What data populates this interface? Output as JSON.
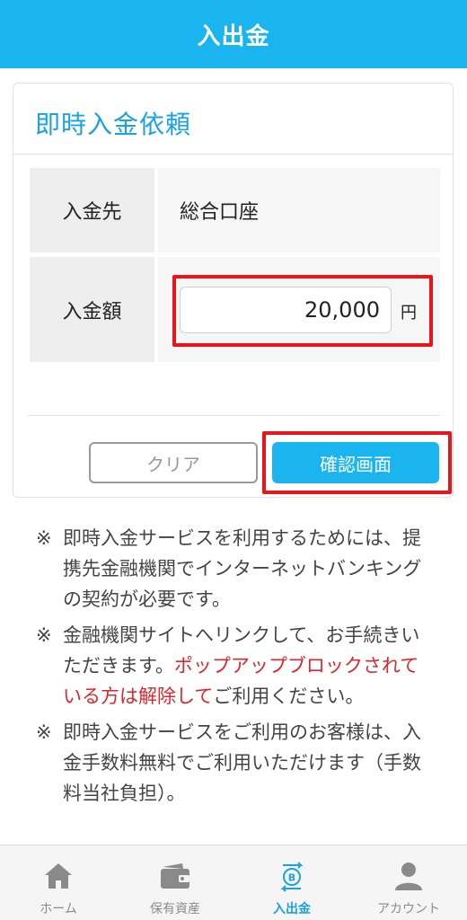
{
  "header": {
    "title": "入出金"
  },
  "card": {
    "title": "即時入金依頼",
    "rows": [
      {
        "label": "入金先",
        "value": "総合口座"
      },
      {
        "label": "入金額",
        "value": "20,000",
        "unit": "円"
      }
    ]
  },
  "buttons": {
    "clear": "クリア",
    "confirm": "確認画面"
  },
  "notes": [
    {
      "mark": "※",
      "text": "即時入金サービスを利用するためには、提携先金融機関でインターネットバンキングの契約が必要です。"
    },
    {
      "mark": "※",
      "text_before": "金融機関サイトへリンクして、お手続きいただきます。",
      "text_red": "ポップアップブロックされている方は解除して",
      "text_after": "ご利用ください。"
    },
    {
      "mark": "※",
      "text": "即時入金サービスをご利用のお客様は、入金手数料無料でご利用いただけます（手数料当社負担）。"
    }
  ],
  "tabbar": {
    "items": [
      {
        "label": "ホーム",
        "icon": "home-icon"
      },
      {
        "label": "保有資産",
        "icon": "wallet-icon"
      },
      {
        "label": "入出金",
        "icon": "bitcoin-transfer-icon",
        "active": true
      },
      {
        "label": "アカウント",
        "icon": "account-icon"
      }
    ]
  },
  "colors": {
    "accent": "#1ab4ef",
    "highlight": "#e8161b",
    "warning_text": "#e0252c"
  }
}
